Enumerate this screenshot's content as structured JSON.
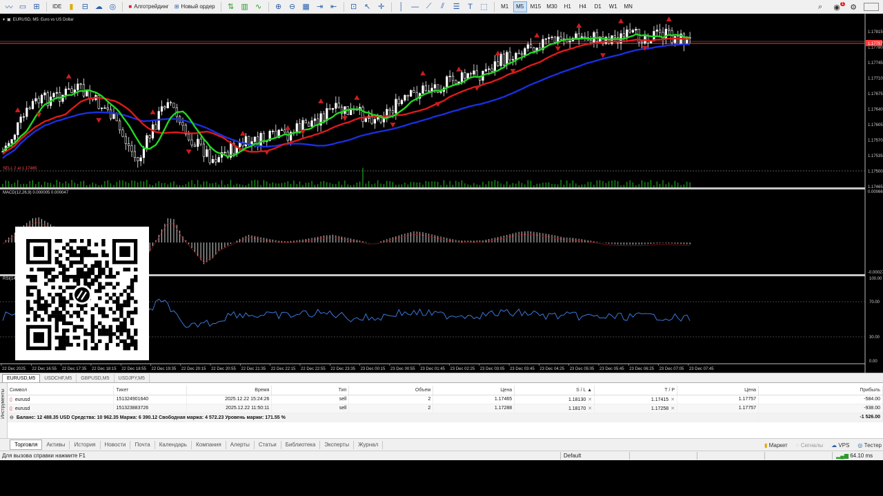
{
  "toolbar": {
    "algo_trading_label": "Алготрейдинг",
    "new_order_label": "Новый ордер",
    "ide_label": "IDE",
    "timeframes": [
      "M1",
      "M5",
      "M15",
      "M30",
      "H1",
      "H4",
      "D1",
      "W1",
      "MN"
    ],
    "active_timeframe": "M5",
    "notifications_count": "1"
  },
  "chart": {
    "title": "EURUSD, M5:  Euro vs US Dollar",
    "sell_label": "SELL 2 at 1.17465",
    "macd_label": "MACD(12,26,9) 0.000005 0.000047",
    "rsi_label": "RSI(14)",
    "price_ticks": [
      "1.17815",
      "1.17780",
      "1.17745",
      "1.17710",
      "1.17675",
      "1.17640",
      "1.17605",
      "1.17570",
      "1.17535",
      "1.17500",
      "1.17465"
    ],
    "current_price_tag": "1.17757",
    "macd_ticks": [
      "0.000665",
      "-0.00027"
    ],
    "rsi_ticks": [
      "100.00",
      "70.00",
      "30.00",
      "0.00"
    ],
    "time_ticks": [
      "22 Dec 2025",
      "22 Dec 16:55",
      "22 Dec 17:35",
      "22 Dec 18:15",
      "22 Dec 18:55",
      "22 Dec 19:35",
      "22 Dec 20:15",
      "22 Dec 20:55",
      "22 Dec 21:35",
      "22 Dec 22:15",
      "22 Dec 22:55",
      "22 Dec 23:35",
      "23 Dec 00:15",
      "23 Dec 00:55",
      "23 Dec 01:45",
      "23 Dec 02:25",
      "23 Dec 03:05",
      "23 Dec 03:45",
      "23 Dec 04:25",
      "23 Dec 05:05",
      "23 Dec 05:45",
      "23 Dec 06:25",
      "23 Dec 07:05",
      "23 Dec 07:45"
    ],
    "colors": {
      "background": "#000000",
      "bull_candle": "#ffffff",
      "bear_candle": "#ffffff",
      "ma_fast": "#22d822",
      "ma_mid": "#e01a1a",
      "ma_slow": "#1a2fe0",
      "arrow": "#c81e1e",
      "rsi_line": "#3a78d8",
      "macd_signal": "#c81e1e",
      "sell_line": "#ff3a3a",
      "volume": "#22c822"
    }
  },
  "symbol_tabs": [
    "EURUSD,M5",
    "USDCHF,M5",
    "GBPUSD,M5",
    "USDJPY,M5"
  ],
  "trades": {
    "columns": [
      "Символ",
      "Тикет",
      "Время",
      "Тип",
      "Объем",
      "Цена",
      "S / L",
      "T / P",
      "Цена",
      "Прибыль"
    ],
    "rows": [
      [
        "eurusd",
        "151324901640",
        "2025.12.22 15:24:26",
        "sell",
        "2",
        "1.17465",
        "1.18130",
        "1.17415",
        "1.17757",
        "-584.00"
      ],
      [
        "eurusd",
        "151323883726",
        "2025.12.22 11:50:11",
        "sell",
        "2",
        "1.17288",
        "1.18170",
        "1.17258",
        "1.17757",
        "-938.00"
      ]
    ],
    "summary": "Баланс: 12 488.35 USD  Средства: 10 962.35  Маржа: 6 390.12  Свободная маржа: 4 572.23  Уровень маржи: 171.55 %",
    "summary_profit": "-1 526.00"
  },
  "side_label": "Инструменты",
  "bottom_tabs": [
    "Торговля",
    "Активы",
    "История",
    "Новости",
    "Почта",
    "Календарь",
    "Компания",
    "Алерты",
    "Статьи",
    "Библиотека",
    "Эксперты",
    "Журнал"
  ],
  "bottom_right": {
    "market": "Маркет",
    "signals": "Сигналы",
    "vps": "VPS",
    "tester": "Тестер"
  },
  "status": {
    "help": "Для вызова справки нажмите F1",
    "profile": "Default",
    "ping": "64.10 ms"
  }
}
